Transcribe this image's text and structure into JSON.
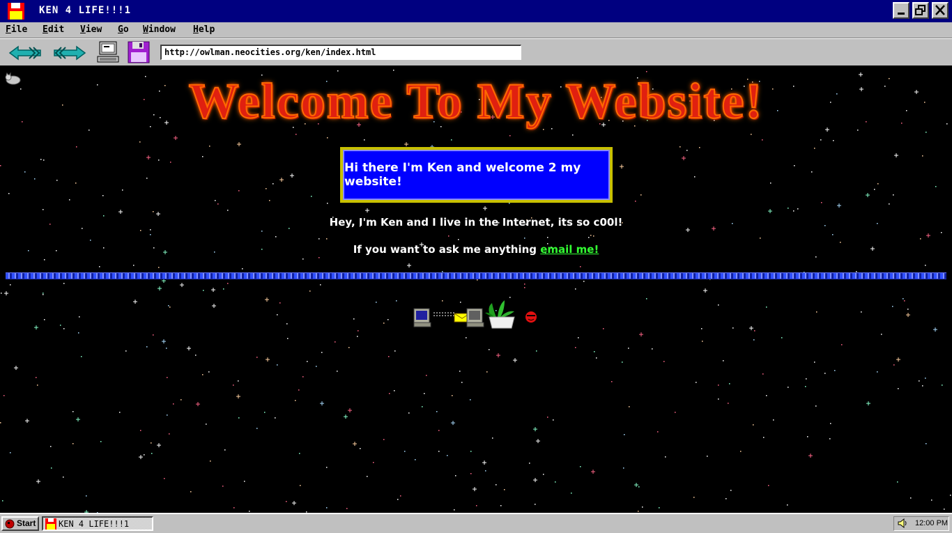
{
  "window": {
    "title": "KEN 4 LIFE!!!1",
    "buttons": [
      "minimize",
      "maximize",
      "close"
    ]
  },
  "menu": {
    "items": [
      "File",
      "Edit",
      "View",
      "Go",
      "Window",
      "Help"
    ]
  },
  "toolbar": {
    "icons": [
      "back-arrow-icon",
      "forward-arrow-icon",
      "computer-icon",
      "floppy-disk-icon"
    ],
    "address": "http://owlman.neocities.org/ken/index.html"
  },
  "page": {
    "heading": "Welcome To My Website!",
    "welcome_box": "Hi there I'm Ken and welcome 2 my website!",
    "line1": "Hey, I'm Ken and I live in the Internet, its so c00l!",
    "line2_prefix": "If you want to ask me anything ",
    "email_link": "email me!"
  },
  "taskbar": {
    "start_label": "Start",
    "task_label": "KEN 4 LIFE!!!1",
    "clock": "12:00 PM"
  },
  "colors": {
    "titlebar": "#000080",
    "chrome": "#c0c0c0",
    "welcome_box_fill": "#0000ff",
    "welcome_box_border": "#c8c000",
    "link": "#33ff33",
    "heading": "#e02010"
  }
}
